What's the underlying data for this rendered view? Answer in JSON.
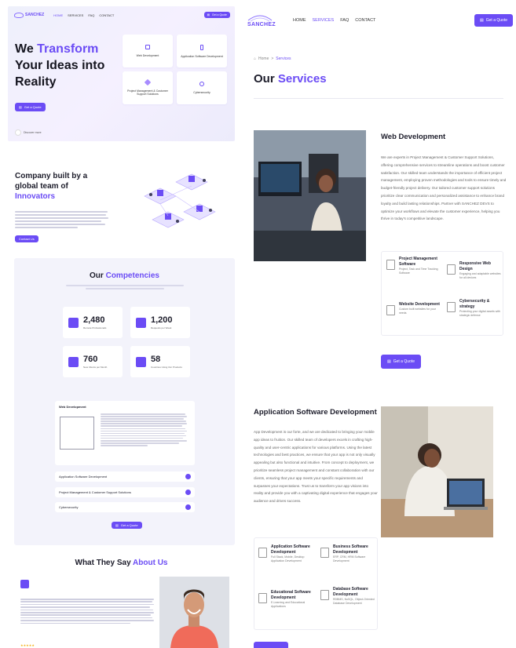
{
  "left": {
    "nav": {
      "logo": "SANCHEZ",
      "links": [
        "HOME",
        "SERVICES",
        "FAQ",
        "CONTACT"
      ],
      "active_index": 0,
      "cta": "Get a Quote"
    },
    "hero": {
      "title_pre": "We ",
      "title_accent": "Transform",
      "title_post": " Your Ideas into Reality",
      "cta": "Get a Quote",
      "footer_text": "Discover more",
      "cards": [
        {
          "label": "Web Development",
          "icon": "monitor-icon"
        },
        {
          "label": "Application Software Development",
          "icon": "mobile-icon"
        },
        {
          "label": "Project Management & Customer Support Solutions",
          "icon": "diamond-icon"
        },
        {
          "label": "Cybersecurity",
          "icon": "search-icon"
        }
      ]
    },
    "about": {
      "title_pre": "Company built by a global team of ",
      "title_accent": "Innovators",
      "cta": "Contact Us"
    },
    "competencies": {
      "title_pre": "Our ",
      "title_accent": "Competencies",
      "stats": [
        {
          "num": "2,480",
          "label": "Remote Professionals",
          "icon": "headset-icon"
        },
        {
          "num": "1,200",
          "label": "Requests per Week",
          "icon": "chat-icon"
        },
        {
          "num": "760",
          "label": "New Clients per Month",
          "icon": "users-icon"
        },
        {
          "num": "58",
          "label": "Countries Using Our Products",
          "icon": "globe-icon"
        }
      ],
      "open_item": "Web Development",
      "items": [
        "Application Software Development",
        "Project Management & Customer Support Solutions",
        "Cybersecurity"
      ],
      "cta": "Get a Quote"
    },
    "testimonials": {
      "title_pre": "What They Say ",
      "title_accent": "About Us",
      "stars": "★★★★★"
    }
  },
  "right": {
    "nav": {
      "logo": "SANCHEZ",
      "links": [
        "HOME",
        "SERVICES",
        "FAQ",
        "CONTACT"
      ],
      "active_index": 1,
      "cta": "Get a Quote"
    },
    "breadcrumb": {
      "home": "Home",
      "sep": ">",
      "current": "Services"
    },
    "title_pre": "Our ",
    "title_accent": "Services",
    "web": {
      "title": "Web Development",
      "body": "We are experts in Project Management & Customer Support Solutions, offering comprehensive services to streamline operations and boost customer satisfaction. Our skilled team understands the importance of efficient project management, employing proven methodologies and tools to ensure timely and budget-friendly project delivery. Our tailored customer support solutions prioritize clear communication and personalized assistance to enhance brand loyalty and build lasting relationships. Partner with SANCHEZ DEVS to optimize your workflows and elevate the customer experience, helping you thrive in today's competitive landscape.",
      "features": [
        {
          "title": "Project Management Software",
          "desc": "Project, Task and Time Tracking Software"
        },
        {
          "title": "Responsive Web Design",
          "desc": "Engaging and adaptable websites for all devices"
        },
        {
          "title": "Website Development",
          "desc": "Custom built websites for your needs"
        },
        {
          "title": "Cybersecurity & strategy",
          "desc": "Protecting your digital assets with strategic defense"
        }
      ],
      "cta": "Get a Quote"
    },
    "app": {
      "title": "Application Software Development",
      "body": "App Development is our forte, and we are dedicated to bringing your mobile app ideas to fruition. Our skilled team of developers excels in crafting high-quality and user-centric applications for various platforms. Using the latest technologies and best practices, we ensure that your app is not only visually appealing but also functional and intuitive. From concept to deployment, we prioritize seamless project management and constant collaboration with our clients, ensuring that your app meets your specific requirements and surpasses your expectations. Trust us to transform your app visions into reality and provide you with a captivating digital experience that engages your audience and drives success.",
      "features": [
        {
          "title": "Application Software Development",
          "desc": "Full Stack, Mobile, Desktop Application Development"
        },
        {
          "title": "Business Software Development",
          "desc": "ERP, CRM, HRM Software Development"
        },
        {
          "title": "Educational Software Development",
          "desc": "E-Learning and Educational Applications"
        },
        {
          "title": "Database Software Development",
          "desc": "RDBMS, NoSQL, Object-Oriented Database Development"
        }
      ]
    }
  }
}
